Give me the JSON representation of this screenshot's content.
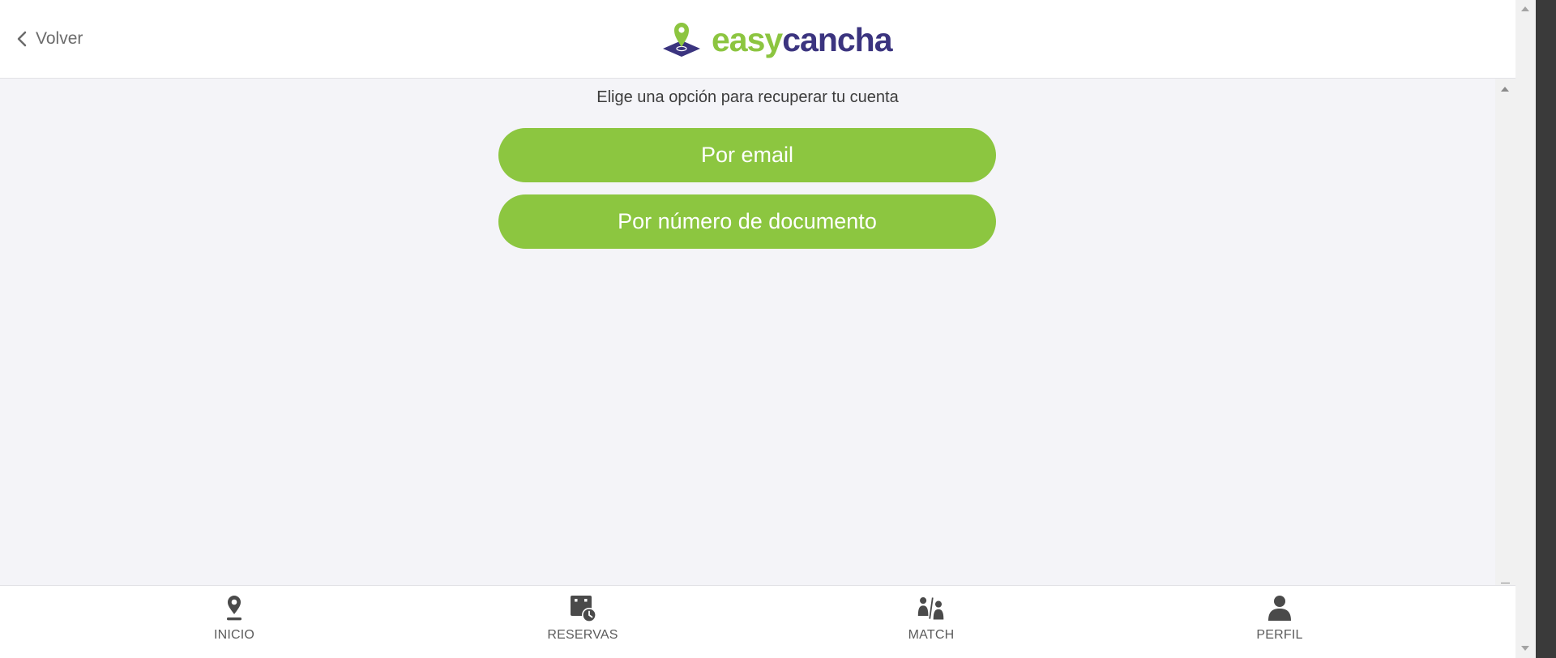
{
  "header": {
    "back_label": "Volver",
    "logo": {
      "easy": "easy",
      "cancha": "cancha"
    }
  },
  "main": {
    "subtitle": "Elige una opción para recuperar tu cuenta",
    "options": [
      {
        "label": "Por email"
      },
      {
        "label": "Por número de documento"
      }
    ]
  },
  "nav": [
    {
      "label": "INICIO",
      "icon": "location-pin-icon"
    },
    {
      "label": "RESERVAS",
      "icon": "calendar-clock-icon"
    },
    {
      "label": "MATCH",
      "icon": "players-match-icon"
    },
    {
      "label": "PERFIL",
      "icon": "person-icon"
    }
  ],
  "colors": {
    "accent_green": "#8cc640",
    "brand_purple": "#3b347f",
    "background": "#f4f4f8",
    "nav_icon": "#4a4a4a"
  }
}
